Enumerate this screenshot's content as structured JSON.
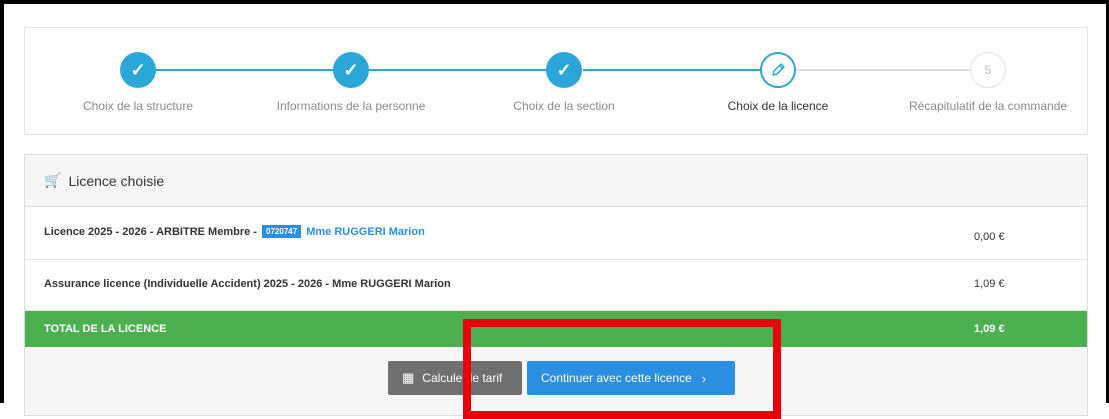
{
  "stepper": {
    "steps": [
      {
        "label": "Choix de la structure",
        "state": "done"
      },
      {
        "label": "Informations de la personne",
        "state": "done"
      },
      {
        "label": "Choix de la section",
        "state": "done"
      },
      {
        "label": "Choix de la licence",
        "state": "active"
      },
      {
        "label": "Récapitulatif de la commande",
        "state": "todo",
        "number": "5"
      }
    ]
  },
  "panel": {
    "title": "Licence choisie",
    "rows": [
      {
        "description": "Licence 2025 - 2026 - ARBITRE Membre -",
        "badge": "0720747",
        "person": "Mme RUGGERI Marion",
        "amount": "0,00 €"
      },
      {
        "description": "Assurance licence (Individuelle Accident) 2025 - 2026 - Mme RUGGERI Marion",
        "amount": "1,09 €"
      }
    ],
    "total": {
      "label": "TOTAL DE LA LICENCE",
      "amount": "1,09 €"
    }
  },
  "actions": {
    "calculate_label": "Calculer le tarif",
    "continue_label": "Continuer avec cette licence"
  },
  "colors": {
    "accent": "#2aa7d8",
    "primary_button": "#2a8fe0",
    "total_row": "#4caf50",
    "highlight": "#e8000b"
  }
}
